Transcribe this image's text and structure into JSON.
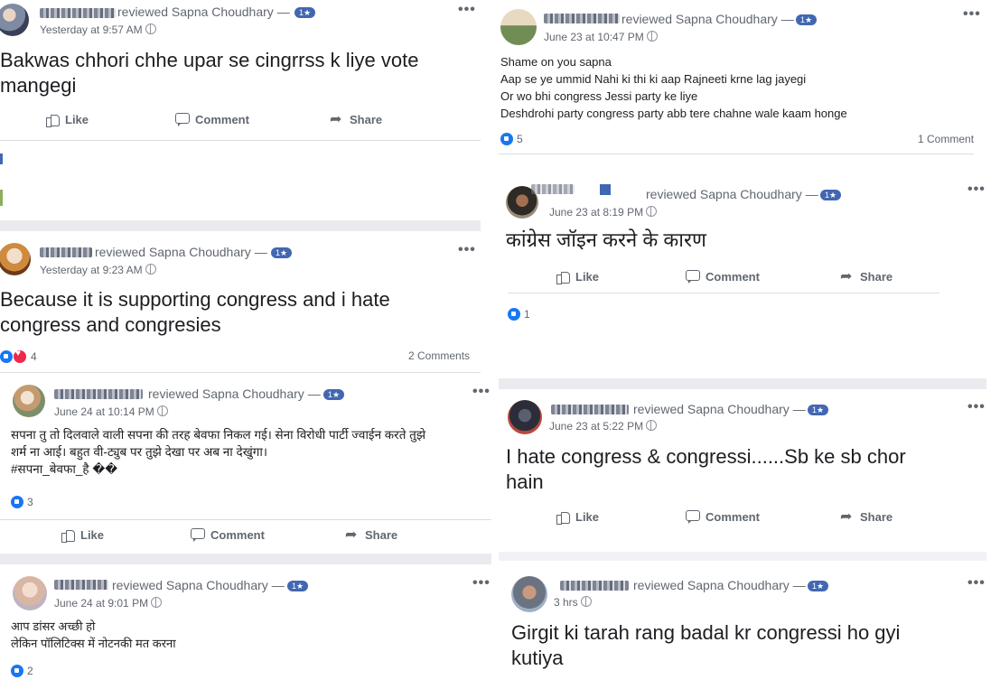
{
  "page_name": "Sapna Choudhary",
  "reviewed_prefix": "reviewed",
  "rating_badge": "1★",
  "actions": {
    "like": "Like",
    "comment": "Comment",
    "share": "Share"
  },
  "reviews": [
    {
      "time": "Yesterday at 9:57 AM",
      "text": "Bakwas chhori chhe upar se cingrrss k liye vote\nmangegi"
    },
    {
      "time": "Yesterday at 9:23 AM",
      "text": "Because it is supporting congress and i hate\ncongress and congresies",
      "reactions": "4",
      "comments": "2 Comments"
    },
    {
      "time": "June 24 at 10:14 PM",
      "text": "सपना तु तो दिलवाले वाली सपना की तरह बेवफा निकल गई। सेना विरोधी पार्टी ज्वाईन करते तुझे\nशर्म ना आई। बहुत वी-ट्युब पर तुझे देखा पर अब ना देखुंगा।\n#सपना_बेवफा_है ��",
      "reactions": "3"
    },
    {
      "time": "June 24 at 9:01 PM",
      "text": "आप डांसर अच्छी हो\nलेकिन पॉलिटिक्स में नोटनकी मत करना",
      "reactions": "2"
    },
    {
      "time": "June 23 at 10:47 PM",
      "text": "Shame on you sapna\nAap se ye ummid Nahi ki thi ki aap Rajneeti krne lag jayegi\nOr wo bhi congress Jessi party ke liye\nDeshdrohi party congress party abb tere chahne wale kaam honge",
      "reactions": "5",
      "comments": "1 Comment"
    },
    {
      "time": "June 23 at 8:19 PM",
      "text": "कांग्रेस जॉइन करने के कारण",
      "reactions": "1"
    },
    {
      "time": "June 23 at 5:22 PM",
      "text": "I hate congress & congressi......Sb ke sb chor\nhain"
    },
    {
      "time": "3 hrs",
      "text": "Girgit ki tarah rang badal kr congressi ho gyi\nkutiya"
    }
  ]
}
